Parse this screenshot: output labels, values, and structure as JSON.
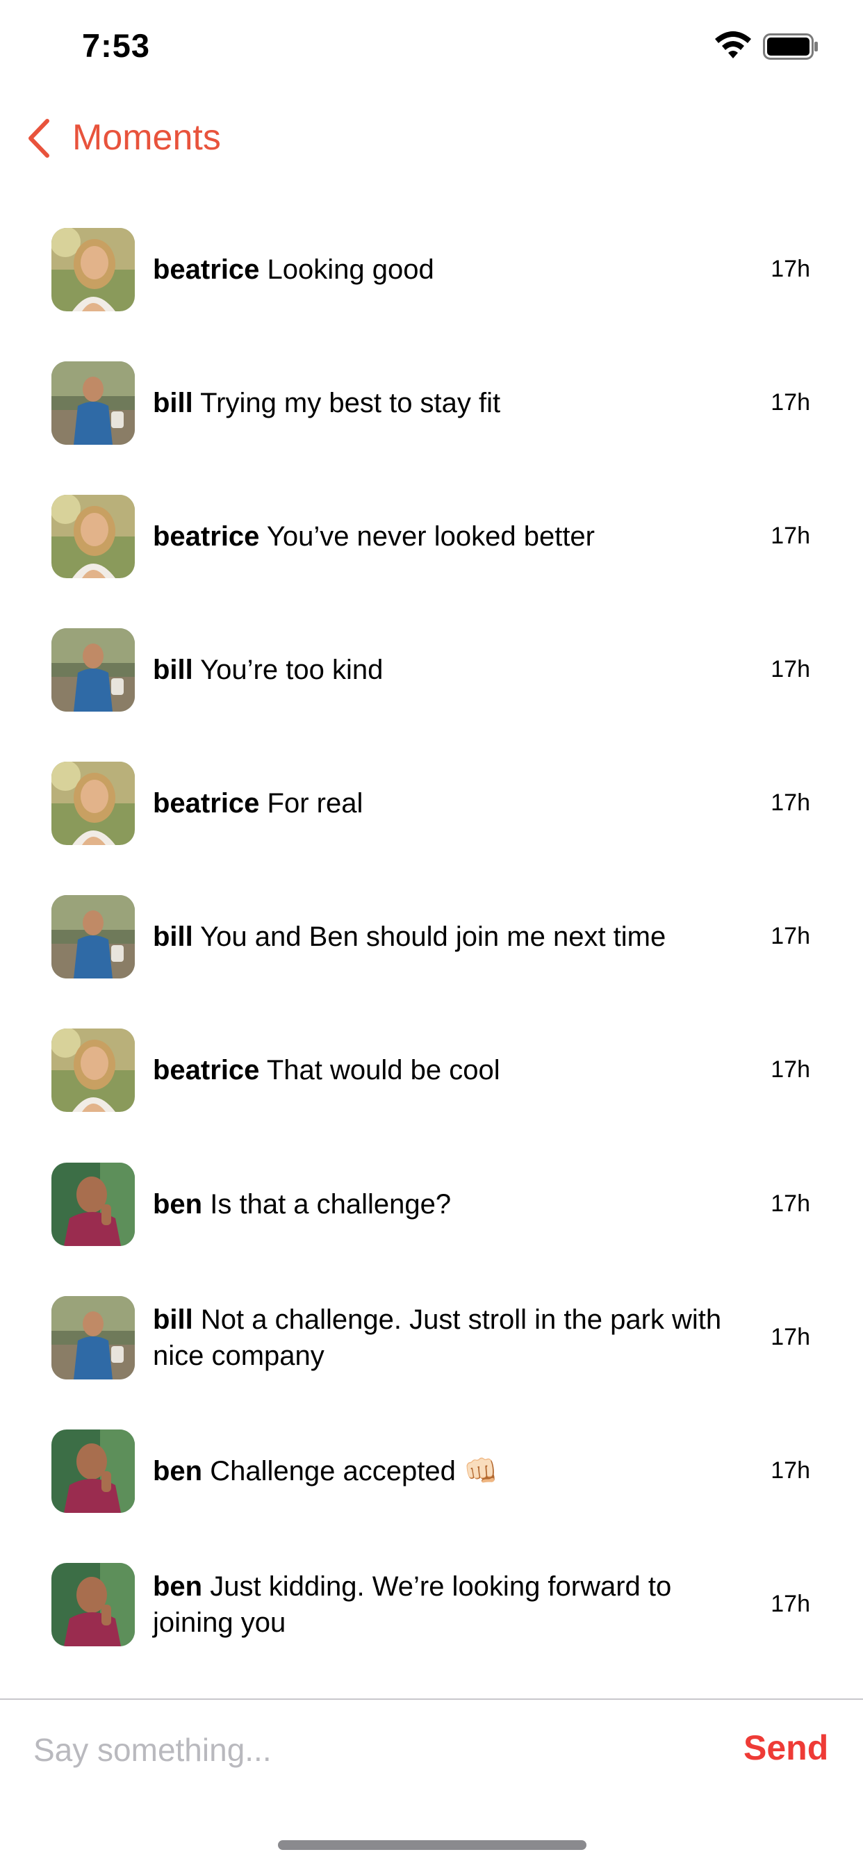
{
  "status_bar": {
    "time": "7:53",
    "wifi_icon": "wifi-icon",
    "battery_icon": "battery-icon"
  },
  "nav": {
    "back_label": "Moments",
    "accent_color": "#e8533c"
  },
  "comments": [
    {
      "user": "beatrice",
      "text": "Looking good",
      "time": "17h",
      "avatar": "beatrice"
    },
    {
      "user": "bill",
      "text": "Trying my best to stay fit",
      "time": "17h",
      "avatar": "bill"
    },
    {
      "user": "beatrice",
      "text": "You’ve never looked better",
      "time": "17h",
      "avatar": "beatrice"
    },
    {
      "user": "bill",
      "text": "You’re too kind",
      "time": "17h",
      "avatar": "bill"
    },
    {
      "user": "beatrice",
      "text": "For real",
      "time": "17h",
      "avatar": "beatrice"
    },
    {
      "user": "bill",
      "text": "You and Ben should join me next time",
      "time": "17h",
      "avatar": "bill"
    },
    {
      "user": "beatrice",
      "text": "That would be cool",
      "time": "17h",
      "avatar": "beatrice"
    },
    {
      "user": "ben",
      "text": "Is that a challenge?",
      "time": "17h",
      "avatar": "ben"
    },
    {
      "user": "bill",
      "text": "Not a challenge. Just stroll in the park with nice company",
      "time": "17h",
      "avatar": "bill"
    },
    {
      "user": "ben",
      "text": "Challenge accepted 👊🏻",
      "time": "17h",
      "avatar": "ben"
    },
    {
      "user": "ben",
      "text": "Just kidding. We’re looking forward to joining you",
      "time": "17h",
      "avatar": "ben"
    }
  ],
  "composer": {
    "placeholder": "Say something...",
    "value": "",
    "send_label": "Send",
    "send_color": "#ee3b36"
  }
}
